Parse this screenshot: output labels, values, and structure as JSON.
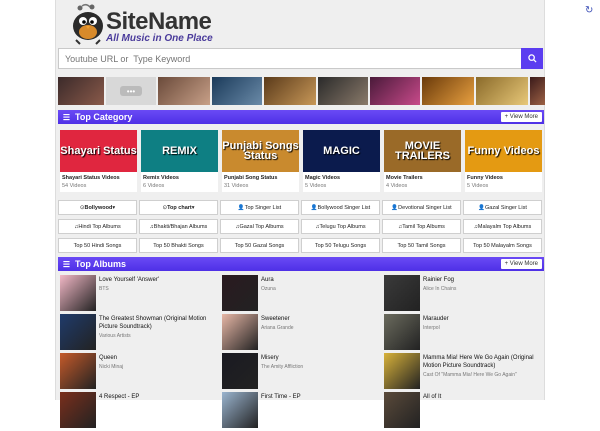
{
  "site": {
    "name": "SiteName",
    "tagline": "All Music in One Place"
  },
  "search": {
    "placeholder": "Youtube URL or  Type Keyword"
  },
  "top_category": {
    "title": "Top Category",
    "view_more": "View More",
    "items": [
      {
        "name": "Shayari Status Videos",
        "count": "54 Videos",
        "label": "Shayari Status",
        "color": "#e0263f"
      },
      {
        "name": "Remix Videos",
        "count": "6 Videos",
        "label": "REMIX",
        "color": "#0e7f83"
      },
      {
        "name": "Punjabi Song Status",
        "count": "31 Videos",
        "label": "Punjabi Songs Status",
        "color": "#c98a2e"
      },
      {
        "name": "Magic Videos",
        "count": "5 Videos",
        "label": "MAGIC",
        "color": "#0b1b4d"
      },
      {
        "name": "Movie Trailers",
        "count": "4 Videos",
        "label": "MOVIE TRAILERS",
        "color": "#9a6a28"
      },
      {
        "name": "Funny Videos",
        "count": "5 Videos",
        "label": "Funny Videos",
        "color": "#e49a12"
      }
    ]
  },
  "nav_rows": [
    [
      "Bollywood",
      "Top chart",
      "Top Singer List",
      "Bollywood Singer List",
      "Devotional Singer List",
      "Gazal Singer List"
    ],
    [
      "Hindi Top Albums",
      "Bhakti/Bhajan Albums",
      "Gazal Top Albums",
      "Telugu Top Albums",
      "Tamil Top Albums",
      "Malayalm Top Albums"
    ],
    [
      "Top 50 Hindi Songs",
      "Top 50 Bhakti Songs",
      "Top 50 Gazal Songs",
      "Top 50 Telugu Songs",
      "Top 50 Tamil Songs",
      "Top 50 Malayalm Songs"
    ]
  ],
  "top_albums": {
    "title": "Top Albums",
    "view_more": "View More",
    "items": [
      {
        "title": "Love Yourself   'Answer'",
        "artist": "BTS",
        "color": "#f2b8c6"
      },
      {
        "title": "Aura",
        "artist": "Ozuna",
        "color": "#2a1a20"
      },
      {
        "title": "Rainier Fog",
        "artist": "Alice In Chains",
        "color": "#3a3a3a"
      },
      {
        "title": "The Greatest Showman (Original Motion Picture Soundtrack)",
        "artist": "Various Artists",
        "color": "#1f3b6b"
      },
      {
        "title": "Sweetener",
        "artist": "Ariana Grande",
        "color": "#e7b7a6"
      },
      {
        "title": "Marauder",
        "artist": "Interpol",
        "color": "#6b6b5e"
      },
      {
        "title": "Queen",
        "artist": "Nicki Minaj",
        "color": "#c55a2a"
      },
      {
        "title": "Misery",
        "artist": "The Amity Affliction",
        "color": "#1a1a22"
      },
      {
        "title": "Mamma Mia! Here We Go Again (Original Motion Picture Soundtrack)",
        "artist": "Cast Of \"Mamma Mia! Here We Go Again\"",
        "color": "#d8b23a"
      },
      {
        "title": "4 Respect - EP",
        "artist": "",
        "color": "#7a2f1c"
      },
      {
        "title": "First Time - EP",
        "artist": "",
        "color": "#9ab4cf"
      },
      {
        "title": "All of It",
        "artist": "",
        "color": "#5a4a3a"
      }
    ]
  }
}
